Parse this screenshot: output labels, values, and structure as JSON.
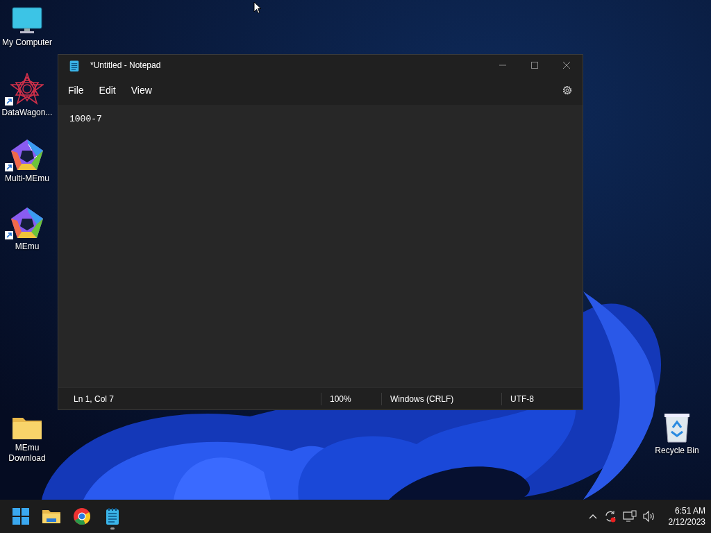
{
  "desktop_icons": [
    {
      "kind": "computer",
      "label": "My Computer",
      "shortcut": false
    },
    {
      "kind": "star-app",
      "label": "DataWagon...",
      "shortcut": true
    },
    {
      "kind": "multi-pentagon",
      "label": "Multi-MEmu",
      "shortcut": true
    },
    {
      "kind": "pentagon",
      "label": "MEmu",
      "shortcut": true
    },
    {
      "kind": "folder",
      "label": "MEmu Download",
      "shortcut": false
    },
    {
      "kind": "recycle",
      "label": "Recycle Bin",
      "shortcut": false
    }
  ],
  "window": {
    "title": "*Untitled - Notepad",
    "menu": [
      "File",
      "Edit",
      "View"
    ],
    "text": "1000-7",
    "status_bar": [
      "Ln 1, Col 7",
      "100%",
      "Windows (CRLF)",
      "UTF-8"
    ]
  },
  "taskbar": {
    "apps": [
      {
        "kind": "start",
        "running": false
      },
      {
        "kind": "folder",
        "running": false
      },
      {
        "kind": "browser",
        "running": false
      },
      {
        "kind": "notepad",
        "running": true
      }
    ],
    "tray": {
      "time": "6:51 AM",
      "date": "2/12/2023"
    }
  }
}
